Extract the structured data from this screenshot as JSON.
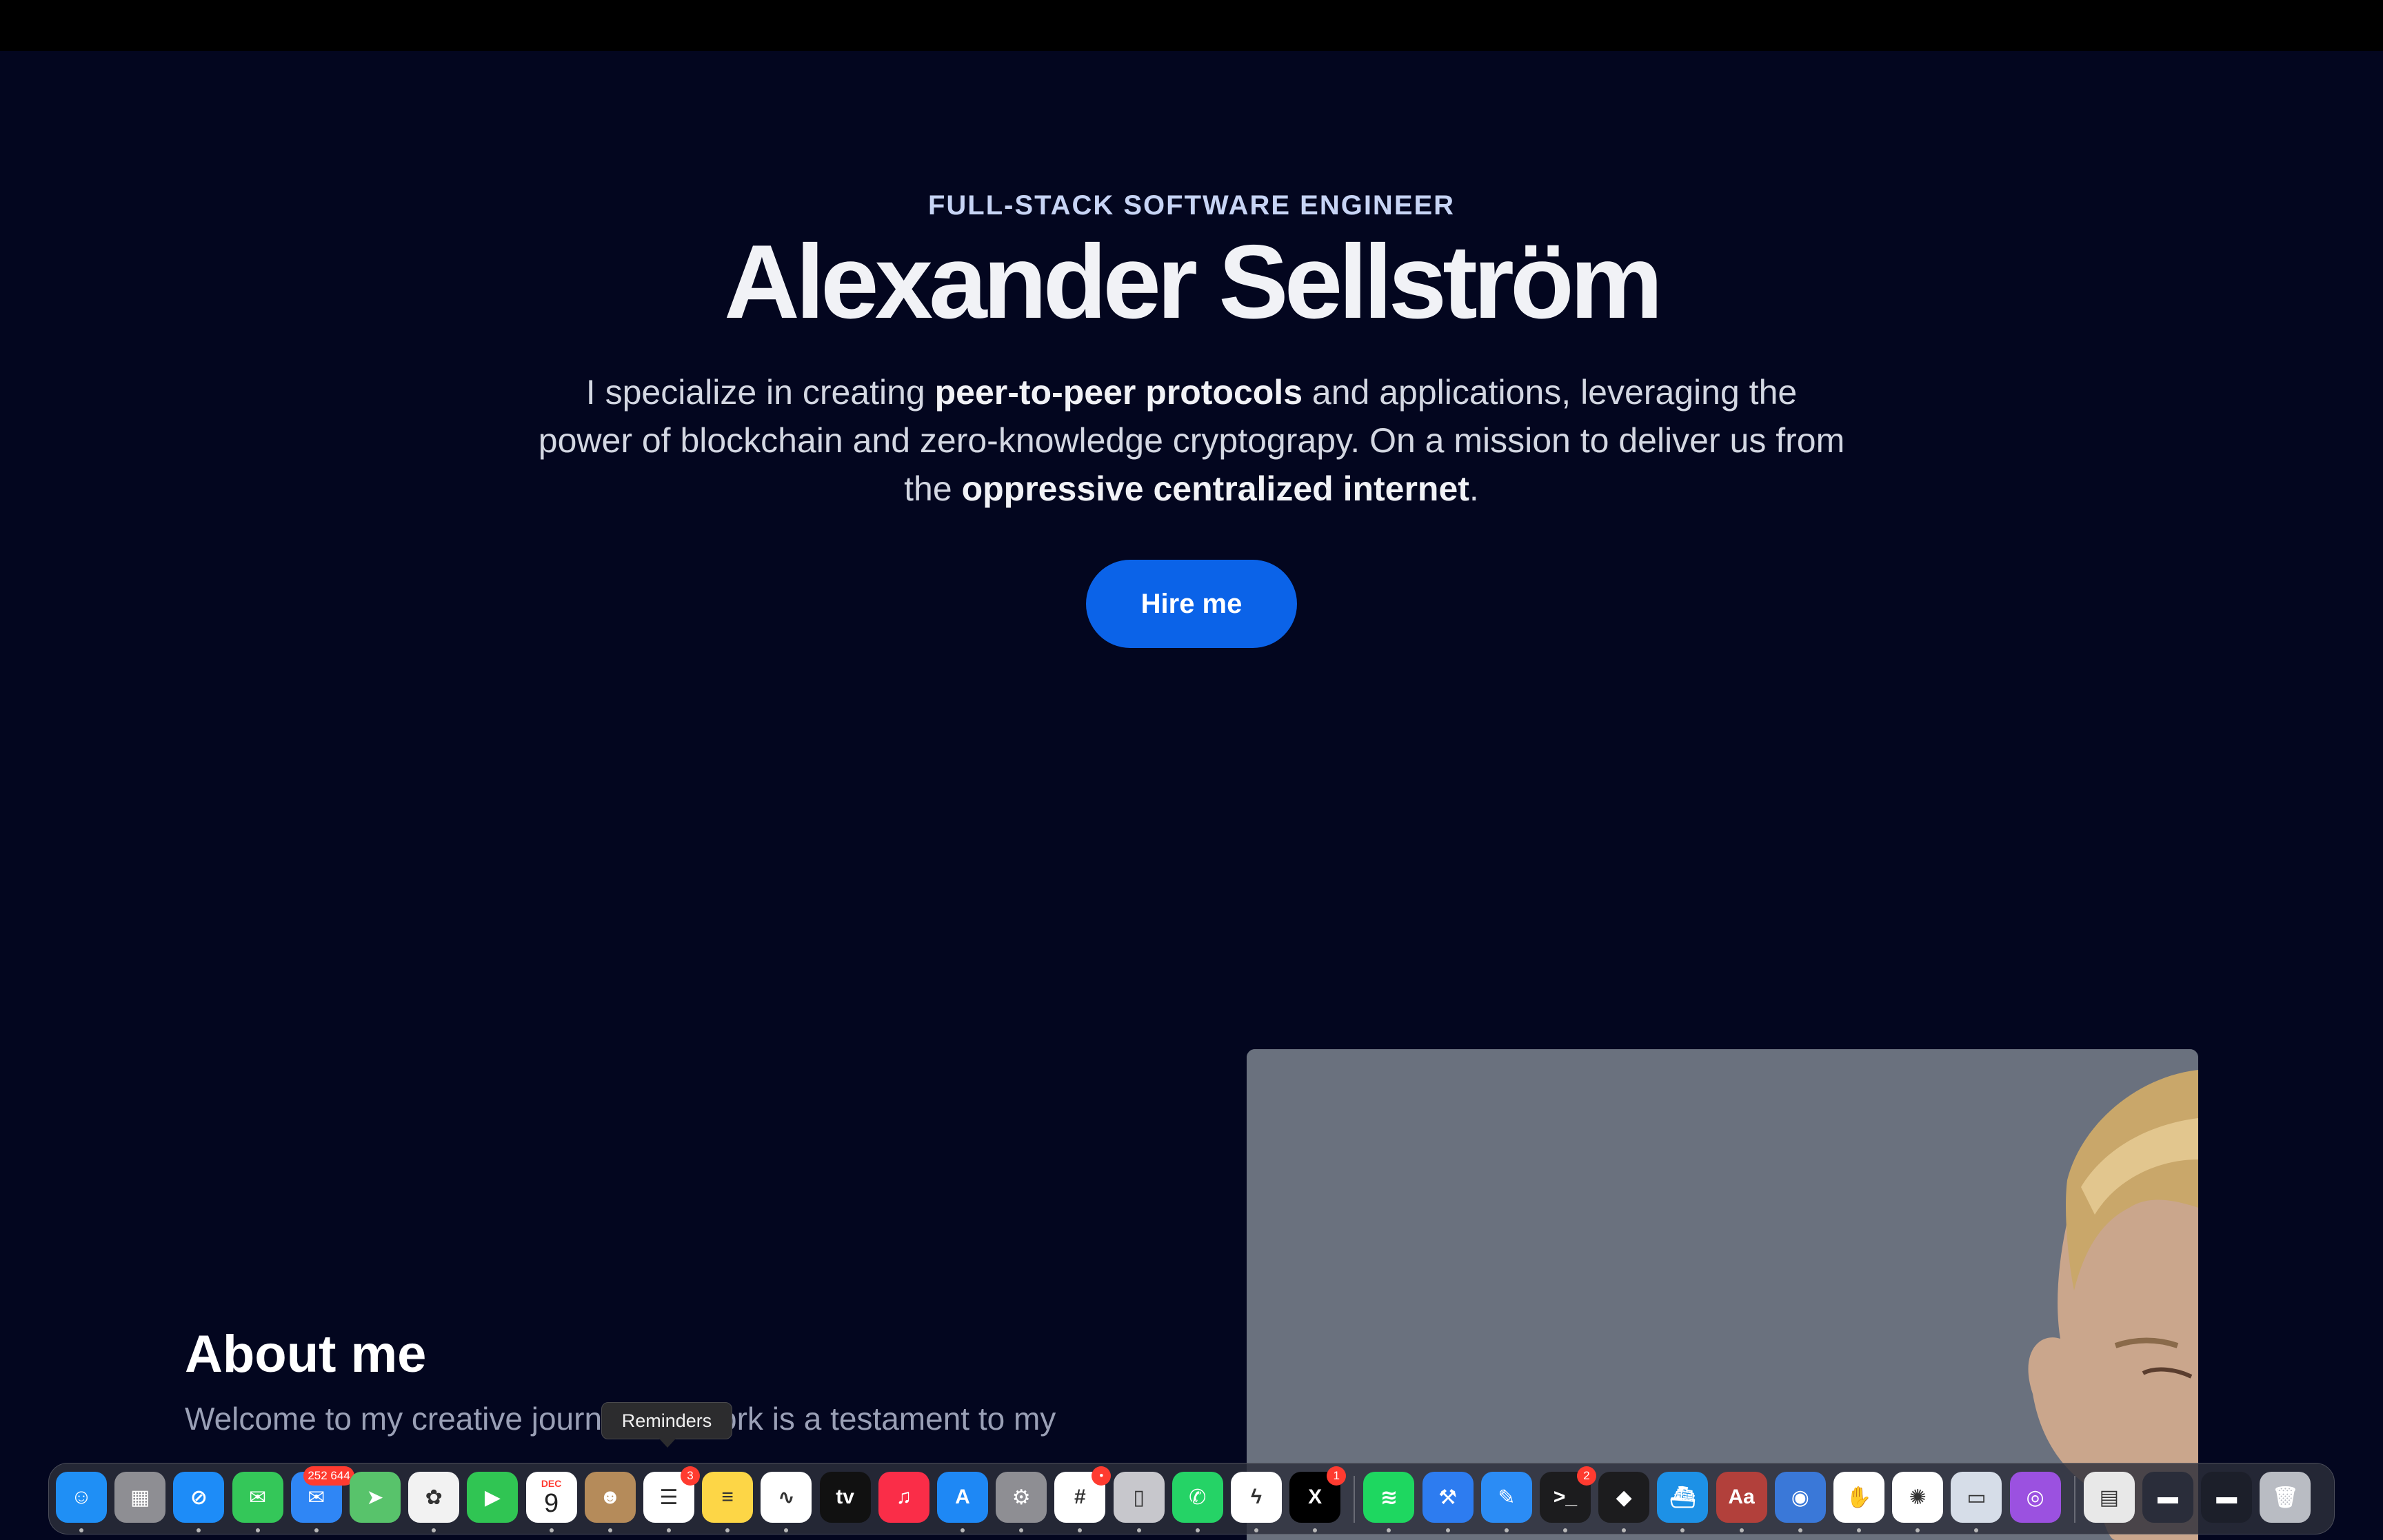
{
  "hero": {
    "eyebrow": "FULL-STACK SOFTWARE ENGINEER",
    "name": "Alexander Sellström",
    "intro": {
      "part1": "I specialize in creating ",
      "bold1": "peer-to-peer protocols",
      "part2": " and applications, leveraging the power of blockchain and zero-knowledge cryptograpy. On a mission to deliver us from the ",
      "bold2": "oppressive centralized internet",
      "part3": "."
    },
    "cta": "Hire me"
  },
  "about": {
    "heading": "About me",
    "text_left": "Welcome to my creative journ",
    "text_right": "ork is a testament to my"
  },
  "tooltip": {
    "label": "Reminders"
  },
  "calendar": {
    "month": "DEC",
    "day": "9"
  },
  "dock": {
    "items": [
      {
        "name": "finder-icon",
        "color": "#1f8ff5",
        "glyph": "☺",
        "running": true
      },
      {
        "name": "launchpad-icon",
        "color": "#8e8e93",
        "glyph": "▦",
        "running": false
      },
      {
        "name": "safari-icon",
        "color": "#1d8cf8",
        "glyph": "⊘",
        "running": true
      },
      {
        "name": "messages-icon",
        "color": "#34c759",
        "glyph": "✉",
        "running": true
      },
      {
        "name": "mail-icon",
        "color": "#2f86f5",
        "glyph": "✉",
        "running": true,
        "badge": "252 644"
      },
      {
        "name": "maps-icon",
        "color": "#58c36b",
        "glyph": "➤",
        "running": false
      },
      {
        "name": "photos-icon",
        "color": "#f2f2f2",
        "glyph": "✿",
        "running": true
      },
      {
        "name": "facetime-icon",
        "color": "#30c553",
        "glyph": "▶",
        "running": false
      },
      {
        "name": "calendar-icon",
        "color": "#ffffff",
        "glyph": "",
        "running": true
      },
      {
        "name": "contacts-icon",
        "color": "#b58b5a",
        "glyph": "☻",
        "running": true
      },
      {
        "name": "reminders-icon",
        "color": "#ffffff",
        "glyph": "☰",
        "running": true,
        "badge": "3"
      },
      {
        "name": "notes-icon",
        "color": "#fdd646",
        "glyph": "≡",
        "running": true
      },
      {
        "name": "freeform-icon",
        "color": "#ffffff",
        "glyph": "∿",
        "running": true
      },
      {
        "name": "apple-tv-icon",
        "color": "#111111",
        "glyph": "tv",
        "running": false
      },
      {
        "name": "music-icon",
        "color": "#fa2d48",
        "glyph": "♫",
        "running": false
      },
      {
        "name": "app-store-icon",
        "color": "#1e88f5",
        "glyph": "A",
        "running": true
      },
      {
        "name": "system-settings-icon",
        "color": "#8e8e93",
        "glyph": "⚙",
        "running": true
      },
      {
        "name": "slack-icon",
        "color": "#ffffff",
        "glyph": "#",
        "running": true,
        "badge": "•"
      },
      {
        "name": "iphone-mirroring-icon",
        "color": "#c7c7cc",
        "glyph": "▯",
        "running": true
      },
      {
        "name": "whatsapp-icon",
        "color": "#25d366",
        "glyph": "✆",
        "running": true
      },
      {
        "name": "messenger-icon",
        "color": "#ffffff",
        "glyph": "ϟ",
        "running": true
      },
      {
        "name": "x-icon",
        "color": "#000000",
        "glyph": "X",
        "running": true,
        "badge": "1"
      },
      {
        "name": "spotify-icon",
        "color": "#1ed760",
        "glyph": "≋",
        "running": true
      },
      {
        "name": "xcode-icon",
        "color": "#2d7cf0",
        "glyph": "⚒",
        "running": true
      },
      {
        "name": "simulator-icon",
        "color": "#2b8cf5",
        "glyph": "✎",
        "running": true
      },
      {
        "name": "terminal-icon",
        "color": "#1c1c1e",
        "glyph": ">_",
        "running": true,
        "badge": "2"
      },
      {
        "name": "cursor-icon",
        "color": "#1c1c1e",
        "glyph": "◆",
        "running": true
      },
      {
        "name": "docker-icon",
        "color": "#1d91e6",
        "glyph": "⛴",
        "running": true
      },
      {
        "name": "dictionary-icon",
        "color": "#b2403b",
        "glyph": "Aa",
        "running": true
      },
      {
        "name": "preview-icon",
        "color": "#3a78d8",
        "glyph": "◉",
        "running": true
      },
      {
        "name": "hands-app-icon",
        "color": "#ffffff",
        "glyph": "✋",
        "running": true
      },
      {
        "name": "chatgpt-icon",
        "color": "#ffffff",
        "glyph": "✺",
        "running": true
      },
      {
        "name": "screen-sharing-icon",
        "color": "#d6dde8",
        "glyph": "▭",
        "running": true
      },
      {
        "name": "podcasts-icon",
        "color": "#9b51e0",
        "glyph": "◎",
        "running": false
      },
      {
        "name": "document-stack-icon",
        "color": "#e8e8e8",
        "glyph": "▤",
        "running": false
      },
      {
        "name": "window-thumbnail-1-icon",
        "color": "#2a2d3a",
        "glyph": "▬",
        "running": false
      },
      {
        "name": "window-thumbnail-2-icon",
        "color": "#1c1f2a",
        "glyph": "▬",
        "running": false
      },
      {
        "name": "trash-icon",
        "color": "#b9bcc3",
        "glyph": "🗑",
        "running": false
      }
    ]
  }
}
